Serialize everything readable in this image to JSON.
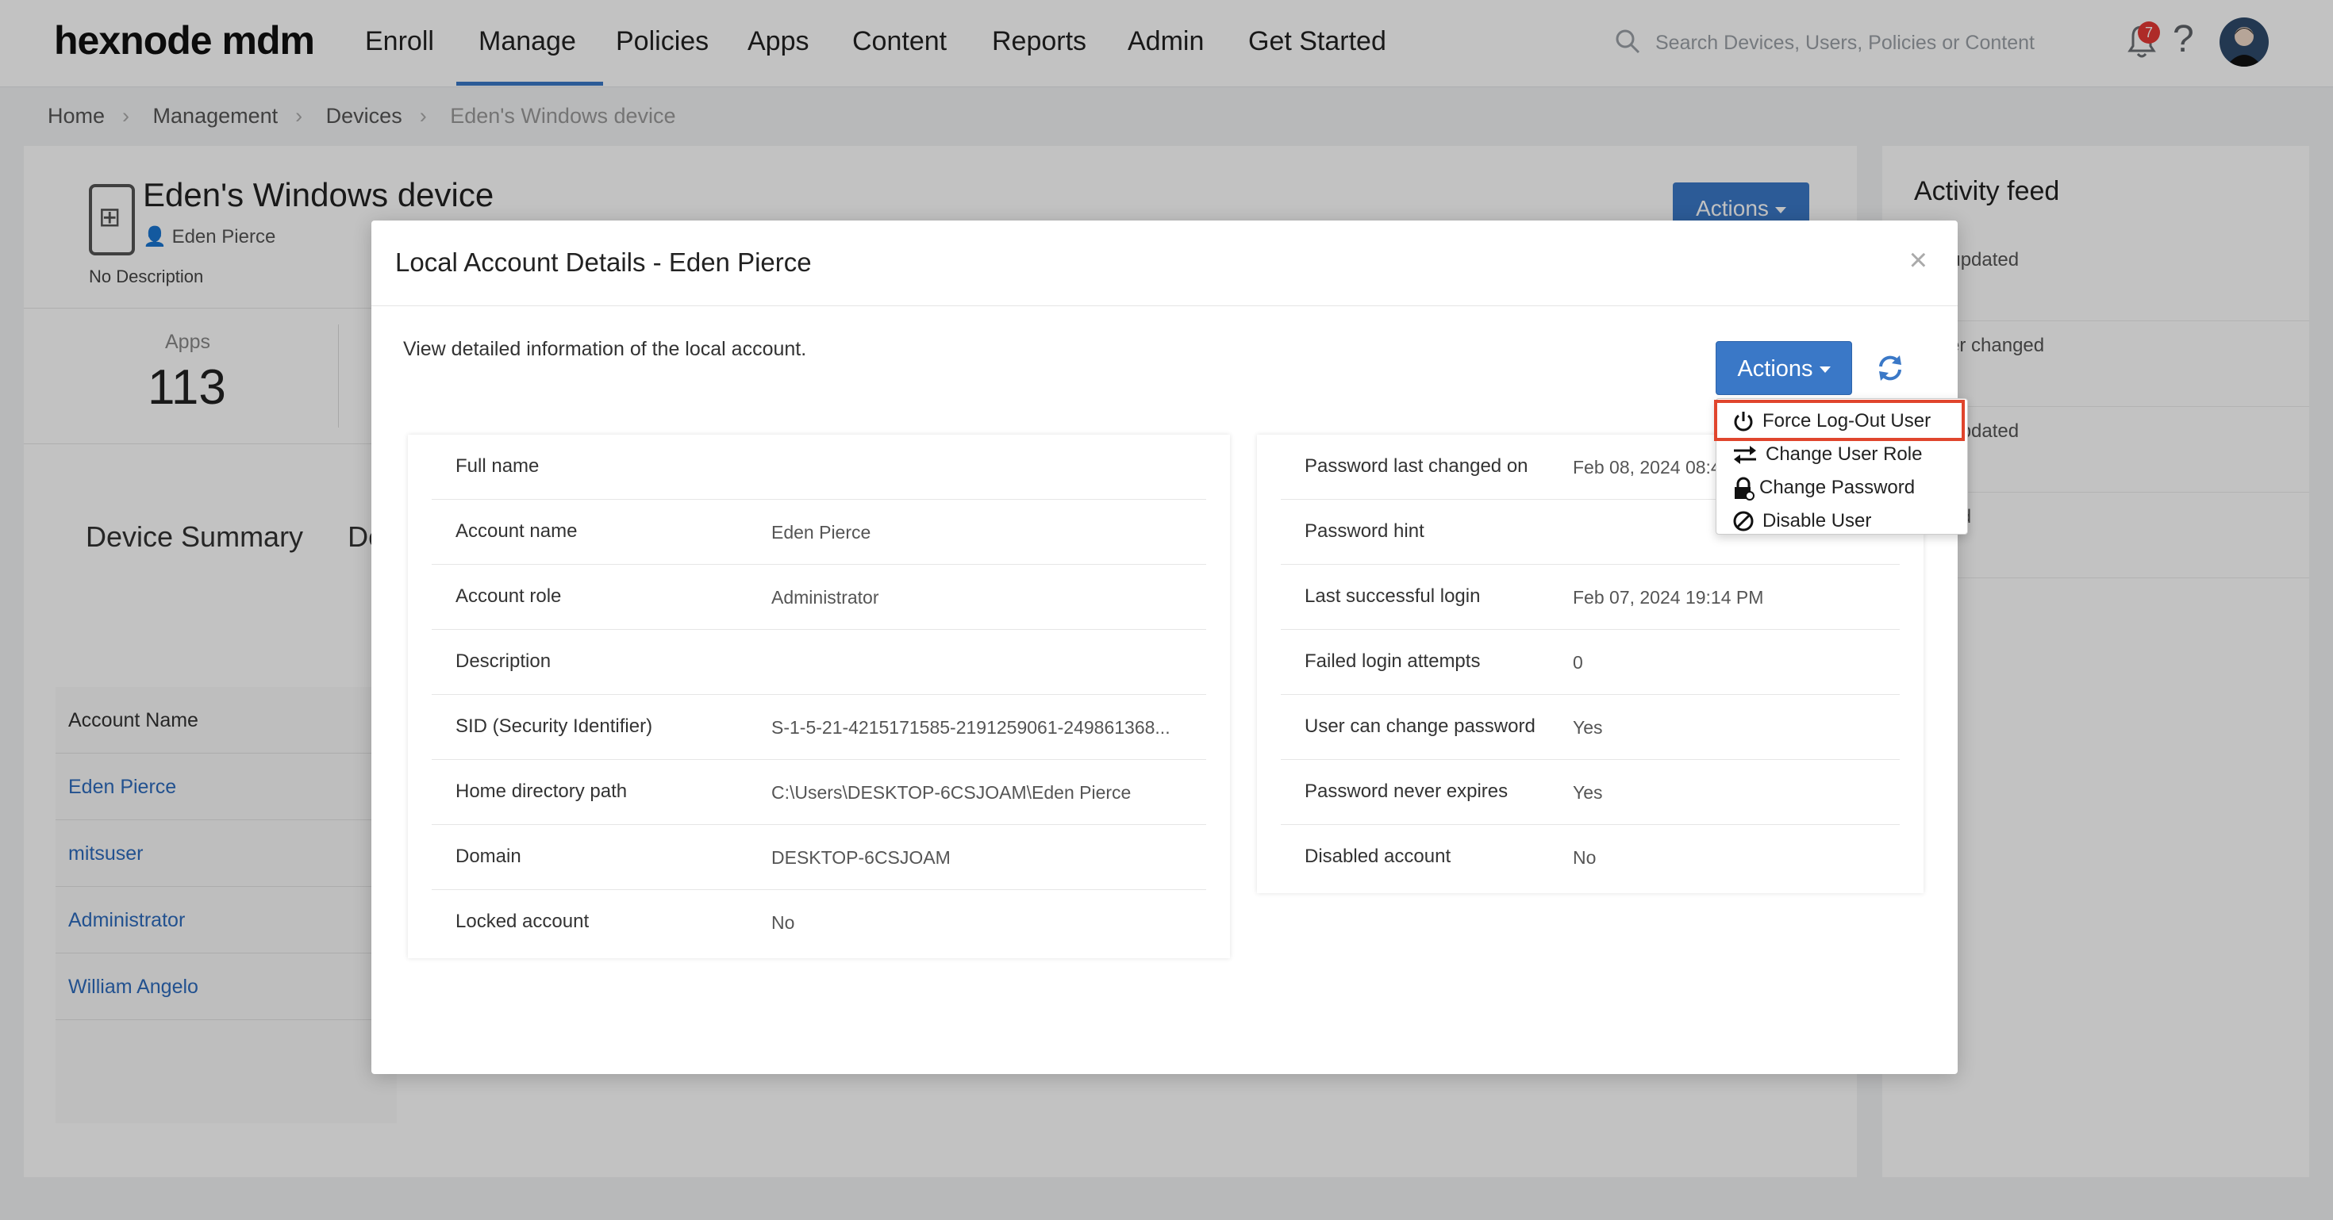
{
  "nav": {
    "logo": "hexnode mdm",
    "items": [
      "Enroll",
      "Manage",
      "Policies",
      "Apps",
      "Content",
      "Reports",
      "Admin",
      "Get Started"
    ],
    "active": "Manage",
    "search_placeholder": "Search Devices, Users, Policies or Content",
    "notification_count": "7",
    "help": "?"
  },
  "breadcrumb": [
    "Home",
    "Management",
    "Devices",
    "Eden's Windows device"
  ],
  "device": {
    "title": "Eden's Windows device",
    "owner": "Eden Pierce",
    "description": "No Description",
    "actions_label": "Actions",
    "apps_label": "Apps",
    "apps_count": "113",
    "tabs": [
      "Device Summary",
      "Dev"
    ],
    "accounts_header": "Account Name",
    "accounts": [
      "Eden Pierce",
      "mitsuser",
      "Administrator",
      "William Angelo"
    ]
  },
  "activity": {
    "title": "Activity feed",
    "items": [
      "info updated",
      "owner changed",
      "ken updated",
      "nrolled"
    ]
  },
  "modal": {
    "title": "Local Account Details - Eden Pierce",
    "close": "×",
    "subtitle": "View detailed information of the local account.",
    "actions_label": "Actions",
    "menu": [
      {
        "label": "Force Log-Out User",
        "icon": "power-icon"
      },
      {
        "label": "Change User Role",
        "icon": "swap-icon"
      },
      {
        "label": "Change Password",
        "icon": "lock-icon"
      },
      {
        "label": "Disable User",
        "icon": "block-icon"
      }
    ],
    "left": [
      {
        "key": "Full name",
        "value": ""
      },
      {
        "key": "Account name",
        "value": "Eden Pierce"
      },
      {
        "key": "Account role",
        "value": "Administrator"
      },
      {
        "key": "Description",
        "value": ""
      },
      {
        "key": "SID (Security Identifier)",
        "value": "S-1-5-21-4215171585-2191259061-249861368..."
      },
      {
        "key": "Home directory path",
        "value": "C:\\Users\\DESKTOP-6CSJOAM\\Eden Pierce"
      },
      {
        "key": "Domain",
        "value": "DESKTOP-6CSJOAM"
      },
      {
        "key": "Locked account",
        "value": "No"
      }
    ],
    "right": [
      {
        "key": "Password last changed on",
        "value": "Feb 08, 2024 08:4"
      },
      {
        "key": "Password hint",
        "value": ""
      },
      {
        "key": "Last successful login",
        "value": "Feb 07, 2024 19:14 PM"
      },
      {
        "key": "Failed login attempts",
        "value": "0"
      },
      {
        "key": "User can change password",
        "value": "Yes"
      },
      {
        "key": "Password never expires",
        "value": "Yes"
      },
      {
        "key": "Disabled account",
        "value": "No"
      }
    ]
  },
  "colors": {
    "primary": "#3a78c7",
    "highlight": "#e0452d",
    "badge": "#e53935"
  }
}
